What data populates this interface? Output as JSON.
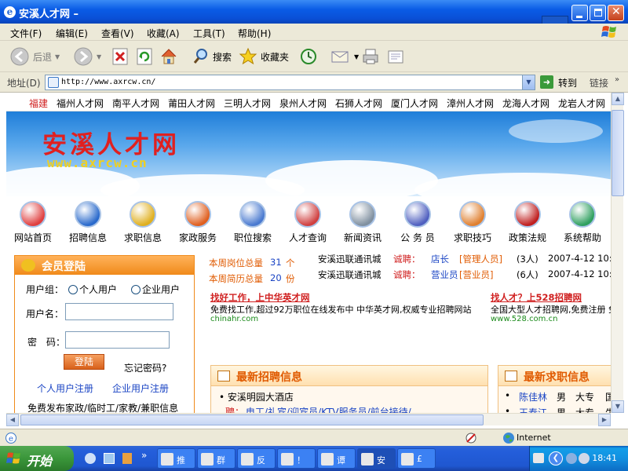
{
  "window": {
    "title": "安溪人才网 –"
  },
  "menubar": [
    "文件(F)",
    "编辑(E)",
    "查看(V)",
    "收藏(A)",
    "工具(T)",
    "帮助(H)"
  ],
  "toolbar": {
    "back": "后退",
    "search": "搜索",
    "favorites": "收藏夹"
  },
  "address": {
    "label": "地址(D)",
    "url": "http://www.axrcw.cn/",
    "go": "转到",
    "links": "链接"
  },
  "city_nav": [
    "福建",
    "福州人才网",
    "南平人才网",
    "莆田人才网",
    "三明人才网",
    "泉州人才网",
    "石狮人才网",
    "厦门人才网",
    "漳州人才网",
    "龙海人才网",
    "龙岩人才网"
  ],
  "banner": {
    "logo": "安溪人才网",
    "url": "www.axrcw.cn"
  },
  "nav_icons": [
    {
      "label": "网站首页",
      "icon": "house-icon",
      "color": "#e04040"
    },
    {
      "label": "招聘信息",
      "icon": "penguin-icon",
      "color": "#2a6acc"
    },
    {
      "label": "求职信息",
      "icon": "runner-icon",
      "color": "#e0b020"
    },
    {
      "label": "家政服务",
      "icon": "basket-icon",
      "color": "#e06020"
    },
    {
      "label": "职位搜索",
      "icon": "magnifier-icon",
      "color": "#4a7ad0"
    },
    {
      "label": "人才查询",
      "icon": "people-icon",
      "color": "#d04040"
    },
    {
      "label": "新闻资讯",
      "icon": "newspaper-icon",
      "color": "#8090a0"
    },
    {
      "label": "公 务 员",
      "icon": "officer-icon",
      "color": "#5060c0"
    },
    {
      "label": "求职技巧",
      "icon": "book-icon",
      "color": "#e08030"
    },
    {
      "label": "政策法规",
      "icon": "law-book-icon",
      "color": "#c02020"
    },
    {
      "label": "系统帮助",
      "icon": "help-icon",
      "color": "#30a060"
    }
  ],
  "login": {
    "title": "会员登陆",
    "group_label": "用户组：",
    "personal": "个人用户",
    "company": "企业用户",
    "username_label": "用户名：",
    "password_label": "密　码：",
    "submit": "登陆",
    "forgot": "忘记密码?",
    "reg_personal": "个人用户注册",
    "reg_company": "企业用户注册",
    "free_post": "免费发布家政/临时工/家教/兼职信息"
  },
  "stats": {
    "jobs_label": "本周岗位总量",
    "jobs_value": "31",
    "jobs_unit": "个",
    "resumes_label": "本周简历总量",
    "resumes_value": "20",
    "resumes_unit": "份"
  },
  "hiring_rows": [
    {
      "company": "安溪迅联通讯城",
      "tag": "诚聘：",
      "position": "店长",
      "type": "[管理人员]",
      "count": "(3人)",
      "date": "2007-4-12 10:"
    },
    {
      "company": "安溪迅联通讯城",
      "tag": "诚聘：",
      "position": "营业员",
      "type": "[营业员]",
      "count": "(6人)",
      "date": "2007-4-12 10:"
    }
  ],
  "ads": [
    {
      "headline": "找好工作，上中华英才网",
      "desc": "免费找工作,超过92万职位在线发布中 中华英才网,权威专业招聘网站",
      "url": "chinahr.com"
    },
    {
      "headline": "找人才？上528招聘网",
      "desc": "全国大型人才招聘网,免费注册 免",
      "url": "www.528.com.cn"
    }
  ],
  "latest_jobs": {
    "title": "最新招聘信息",
    "company": "• 安溪明园大酒店",
    "hire_tag": "聘：",
    "positions": "电工/礼宾/迎宾员/KTV服务员/前台接待/"
  },
  "latest_seekers": {
    "title": "最新求职信息",
    "rows": [
      {
        "name": "陈佳林",
        "gender": "男",
        "edu": "大专",
        "extra": "国"
      },
      {
        "name": "王春江",
        "gender": "男",
        "edu": "大专",
        "extra": "生"
      }
    ]
  },
  "status": {
    "zone": "Internet"
  },
  "taskbar": {
    "start": "开始",
    "tasks": [
      "推",
      "群",
      "反",
      "！",
      "谭",
      "安",
      "£"
    ],
    "clock": "18:41"
  }
}
